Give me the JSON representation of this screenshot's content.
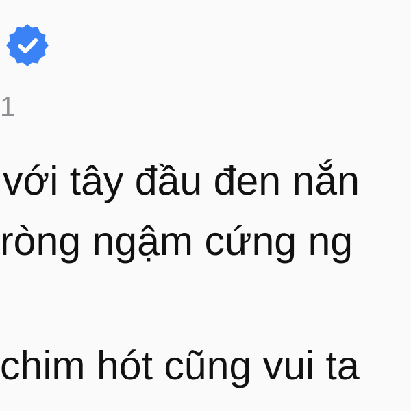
{
  "header": {
    "badge_icon": "verified-badge-icon",
    "badge_color": "#3b82f6",
    "meta_text": "1"
  },
  "post": {
    "lines": [
      "với tây đầu đen nắn",
      " ròng ngậm cứng ng",
      "chim hót cũng vui ta"
    ]
  }
}
